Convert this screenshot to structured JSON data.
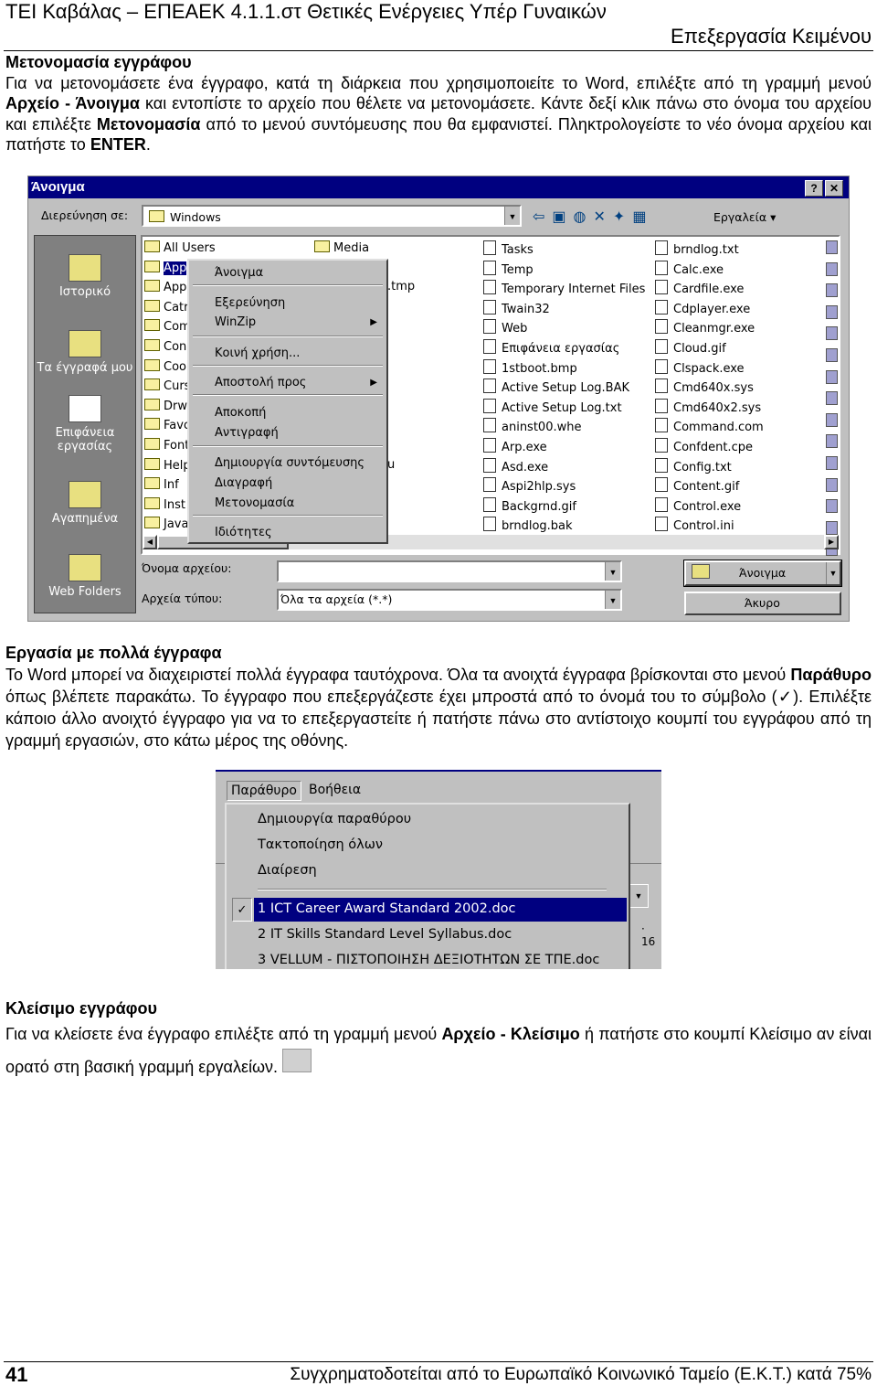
{
  "header": {
    "title": "ΤΕΙ Καβάλας – ΕΠΕΑΕΚ 4.1.1.στ Θετικές Ενέργειες Υπέρ Γυναικών",
    "subtitle": "Επεξεργασία Κειμένου"
  },
  "section1": {
    "heading": "Μετονομασία εγγράφου",
    "t1": "Για να μετονομάσετε ένα έγγραφο, κατά τη διάρκεια που χρησιμοποιείτε το Word, επιλέξτε από τη γραμμή μενού ",
    "b1": "Αρχείο - Άνοιγμα",
    "t2": " και εντοπίστε το αρχείο που θέλετε να μετονομάσετε. Κάντε δεξί κλικ πάνω στο όνομα του αρχείου και επιλέξτε ",
    "b2": "Μετονομασία",
    "t3": " από το μενού συντόμευσης που θα εμφανιστεί. Πληκτρολογείστε το νέο όνομα αρχείου και πατήστε το ",
    "b3": "ENTER",
    "t4": "."
  },
  "dialog": {
    "title": "Άνοιγμα",
    "help": "?",
    "close": "✕",
    "look_in_label": "Διερεύνηση σε:",
    "look_in_value": "Windows",
    "tools_label": "Εργαλεία",
    "places": [
      "Ιστορικό",
      "Τα έγγραφά μου",
      "Επιφάνεια εργασίας",
      "Αγαπημένα",
      "Web Folders"
    ],
    "col1": [
      "All Users",
      "App",
      "App",
      "Catr",
      "Com",
      "Con",
      "Coo",
      "Curs",
      "Drw",
      "Favo",
      "Font",
      "Help",
      "Inf",
      "Inst",
      "Java"
    ],
    "col2": [
      "Media",
      "",
      ".tmp",
      "",
      "",
      "",
      "",
      "",
      "",
      "",
      "",
      "u",
      "",
      "",
      ""
    ],
    "col3": [
      "Tasks",
      "Temp",
      "Temporary Internet Files",
      "Twain32",
      "Web",
      "Επιφάνεια εργασίας",
      "1stboot.bmp",
      "Active Setup Log.BAK",
      "Active Setup Log.txt",
      "aninst00.whe",
      "Arp.exe",
      "Asd.exe",
      "Aspi2hlp.sys",
      "Backgrnd.gif",
      "brndlog.bak"
    ],
    "col4": [
      "brndlog.txt",
      "Calc.exe",
      "Cardfile.exe",
      "Cdplayer.exe",
      "Cleanmgr.exe",
      "Cloud.gif",
      "Clspack.exe",
      "Cmd640x.sys",
      "Cmd640x2.sys",
      "Command.com",
      "Confdent.cpe",
      "Config.txt",
      "Content.gif",
      "Control.exe",
      "Control.ini"
    ],
    "context_menu": [
      "Άνοιγμα",
      "Εξερεύνηση",
      "WinZip",
      "Κοινή χρήση...",
      "Αποστολή προς",
      "Αποκοπή",
      "Αντιγραφή",
      "Δημιουργία συντόμευσης",
      "Διαγραφή",
      "Μετονομασία",
      "Ιδιότητες"
    ],
    "filename_label": "Όνομα αρχείου:",
    "filename_value": "",
    "filetype_label": "Αρχεία τύπου:",
    "filetype_value": "Όλα τα αρχεία (*.*)",
    "open_button": "Άνοιγμα",
    "cancel_button": "Άκυρο"
  },
  "section2": {
    "heading": "Εργασία με πολλά έγγραφα",
    "t1": "Το Word μπορεί να διαχειριστεί πολλά έγγραφα ταυτόχρονα. Όλα τα ανοιχτά έγγραφα βρίσκονται στο μενού ",
    "b1": "Παράθυρο",
    "t2": " όπως βλέπετε παρακάτω. Το έγγραφο που επεξεργάζεστε έχει μπροστά από το όνομά του το σύμβολο (✓). Επιλέξτε κάποιο άλλο ανοιχτό έγγραφο για να το επεξεργαστείτε ή πατήστε πάνω στο αντίστοιχο κουμπί του εγγράφου από τη γραμμή εργασιών, στο κάτω μέρος της οθόνης."
  },
  "window_menu": {
    "menubar": [
      "Παράθυρο",
      "Βοήθεια"
    ],
    "items": [
      "Δημιουργία παραθύρου",
      "Τακτοποίηση όλων",
      "Διαίρεση"
    ],
    "documents": [
      "1 ICT Career Award Standard 2002.doc",
      "2 IT Skills Standard Level Syllabus.doc",
      "3 VELLUM - ΠΙΣΤΟΠΟΙΗΣΗ ΔΕΞΙΟΤΗΤΩΝ ΣΕ ΤΠΕ.doc"
    ],
    "check": "✓",
    "ruler": "· 16"
  },
  "section3": {
    "heading": "Κλείσιμο εγγράφου",
    "t1": "Για να κλείσετε ένα έγγραφο επιλέξτε από τη γραμμή μενού ",
    "b1": "Αρχείο - Κλείσιμο",
    "t2": " ή πατήστε στο κουμπί Κλείσιμο αν είναι ορατό στη βασική γραμμή εργαλείων."
  },
  "footer": {
    "page": "41",
    "text": "Συγχρηματοδοτείται από το Ευρωπαϊκό Κοινωνικό Ταμείο (Ε.Κ.Τ.) κατά 75%"
  }
}
